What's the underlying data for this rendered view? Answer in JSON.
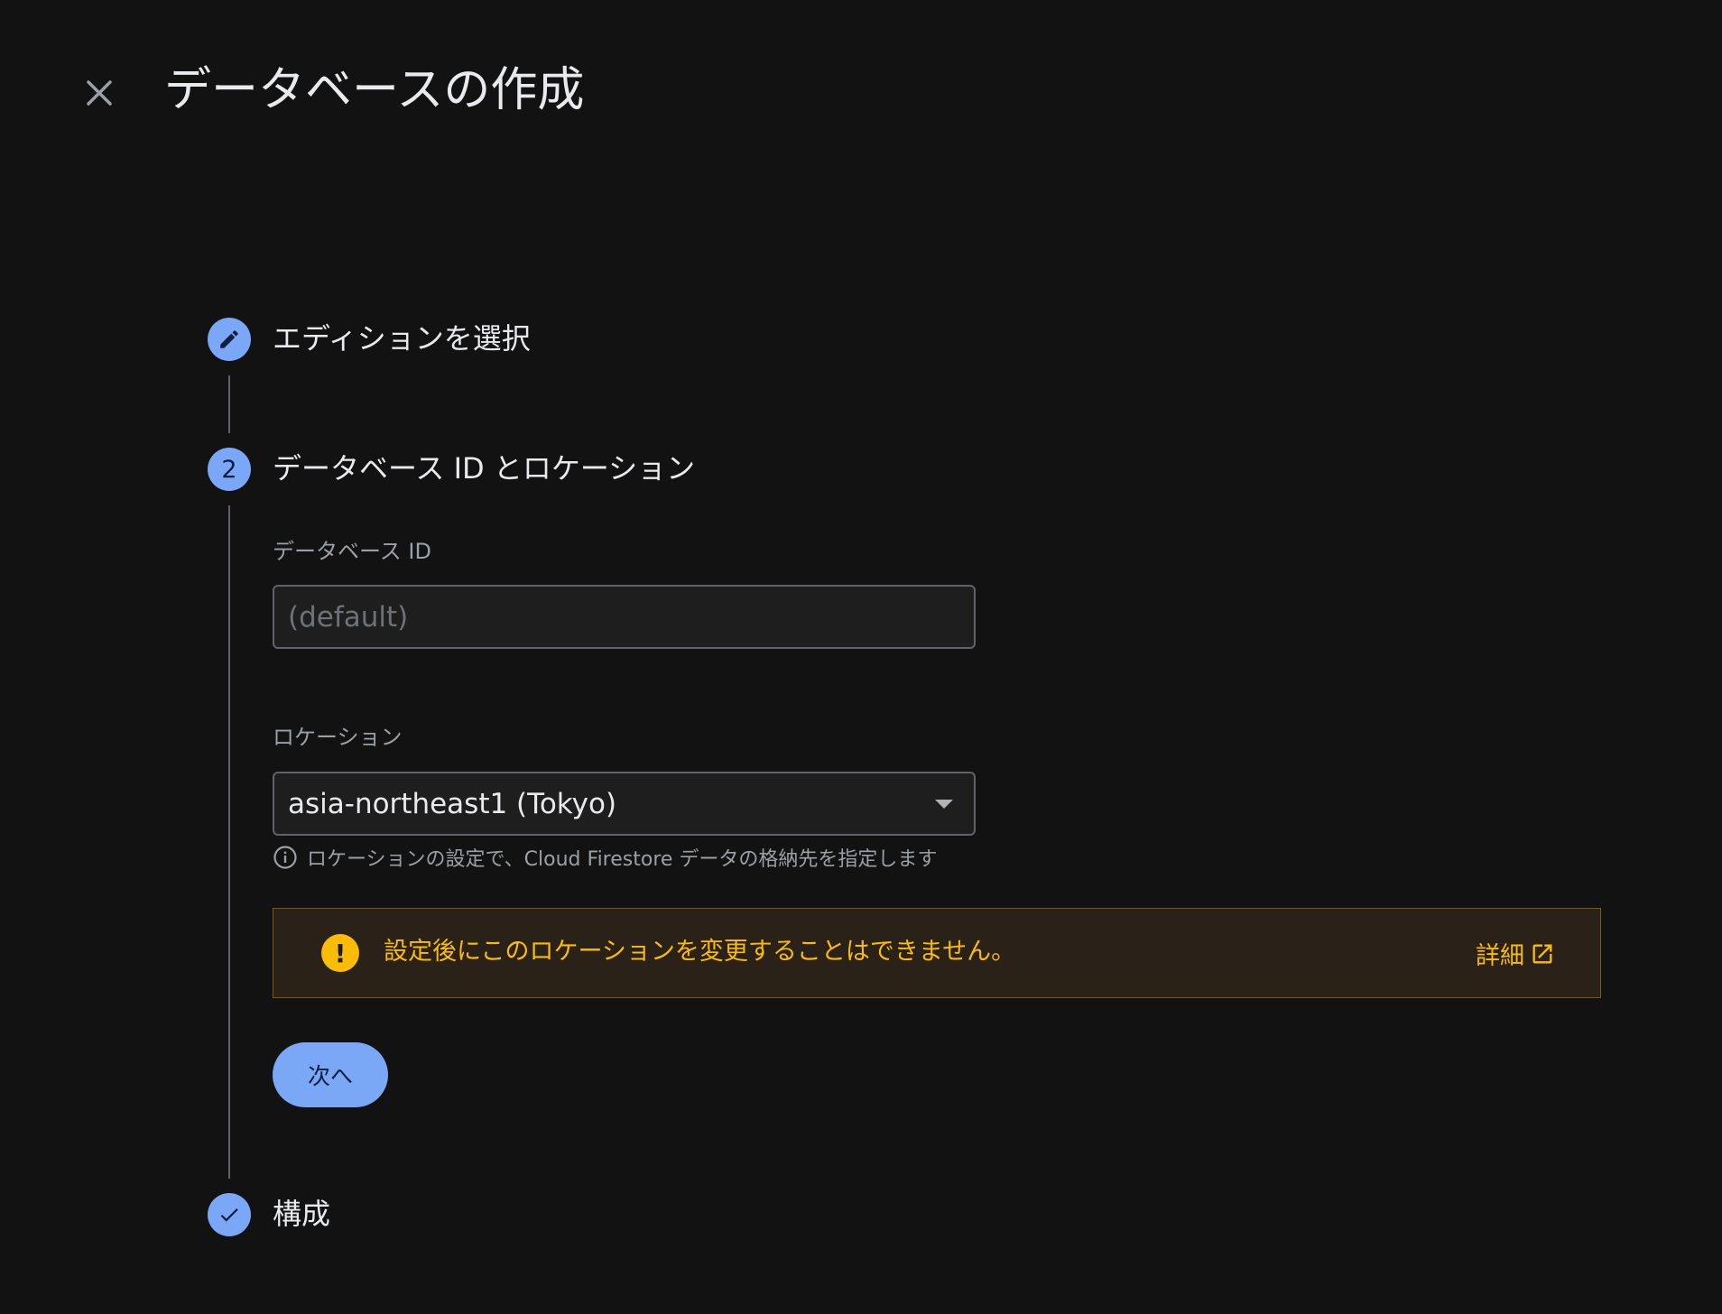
{
  "header": {
    "title": "データベースの作成"
  },
  "stepper": {
    "steps": [
      {
        "label": "エディションを選択",
        "state": "edit",
        "icon": "pencil-icon"
      },
      {
        "label": "データベース ID とロケーション",
        "number": "2",
        "state": "active"
      },
      {
        "label": "構成",
        "state": "done",
        "icon": "check-icon"
      }
    ]
  },
  "form": {
    "database_id": {
      "label": "データベース ID",
      "placeholder": "(default)",
      "value": ""
    },
    "location": {
      "label": "ロケーション",
      "selected": "asia-northeast1 (Tokyo)",
      "hint": "ロケーションの設定で、Cloud Firestore データの格納先を指定します",
      "hint_icon": "info-icon"
    },
    "warning": {
      "text": "設定後にこのロケーションを変更することはできません。",
      "link_label": "詳細",
      "link_icon": "open-in-new-icon",
      "icon": "exclamation-icon"
    },
    "next_label": "次へ"
  },
  "colors": {
    "background": "#121212",
    "accent": "#7ba7f7",
    "warning": "#fbbc04",
    "warning_bg": "#2a2118",
    "warning_border": "#7a5a13"
  }
}
